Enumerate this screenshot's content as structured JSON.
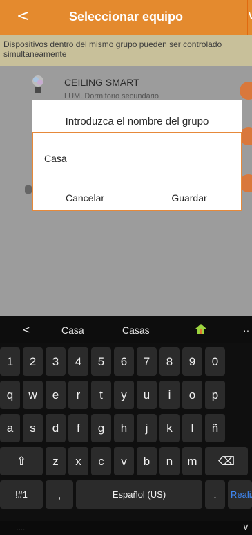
{
  "header": {
    "back": "<",
    "title": "Seleccionar equipo",
    "menu": "∨"
  },
  "notice": {
    "line1": "Dispositivos dentro del mismo grupo pueden ser controlado",
    "line2": "simultaneamente"
  },
  "device": {
    "name": "CEILING SMART",
    "room": "LUM. Dormitorio secundario"
  },
  "dialog": {
    "title": "Introduzca el nombre del grupo",
    "value": "Casa",
    "cancel": "Cancelar",
    "save": "Guardar"
  },
  "suggestions": {
    "back": "<",
    "s1": "Casa",
    "s2": "Casas",
    "more": "··"
  },
  "keyboard": {
    "row1": [
      "1",
      "2",
      "3",
      "4",
      "5",
      "6",
      "7",
      "8",
      "9",
      "0"
    ],
    "row2": [
      "q",
      "w",
      "e",
      "r",
      "t",
      "y",
      "u",
      "i",
      "o",
      "p"
    ],
    "row3": [
      "a",
      "s",
      "d",
      "f",
      "g",
      "h",
      "j",
      "k",
      "l",
      "ñ"
    ],
    "row4": [
      "⇧",
      "z",
      "x",
      "c",
      "v",
      "b",
      "n",
      "m",
      "⌫"
    ],
    "row5": [
      "!#1",
      ",",
      "Español (US)",
      ".",
      "Realiz"
    ]
  },
  "system": {
    "dots": "::::",
    "collapse": "∨"
  },
  "colors": {
    "accent": "#e48a2e",
    "check": "#d9783c",
    "blue": "#3f88f5"
  }
}
